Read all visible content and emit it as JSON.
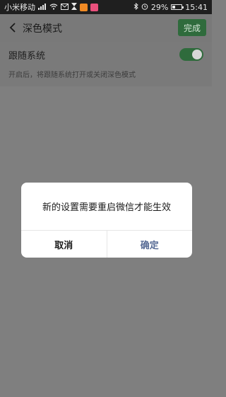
{
  "status_bar": {
    "carrier": "小米移动",
    "battery": "29%",
    "time": "15:41",
    "colors": {
      "background": "#1f1f1f",
      "text": "#e8e8e8"
    }
  },
  "header": {
    "title": "深色模式",
    "done_label": "完成",
    "back_icon": "chevron-left-icon"
  },
  "settings": {
    "follow_system": {
      "label": "跟随系统",
      "description": "开启后，将跟随系统打开或关闭深色模式",
      "enabled": true
    }
  },
  "dialog": {
    "message": "新的设置需要重启微信才能生效",
    "cancel_label": "取消",
    "confirm_label": "确定",
    "confirm_color": "#576b95"
  }
}
